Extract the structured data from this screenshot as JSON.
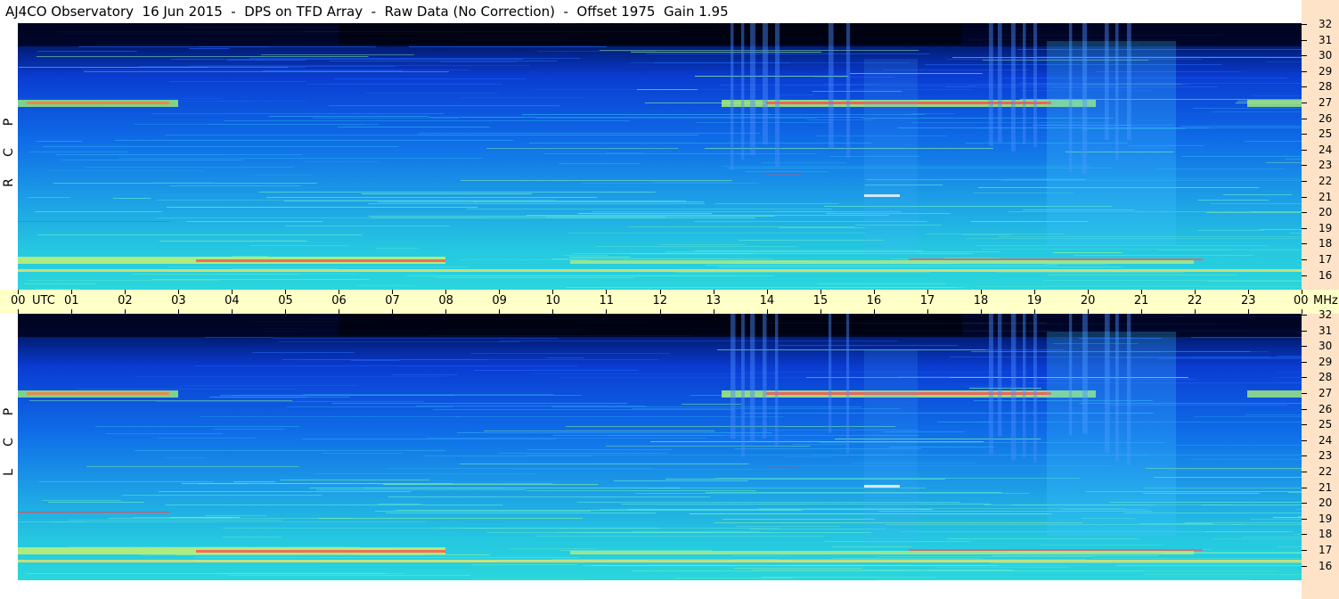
{
  "header": {
    "title": "AJ4CO Observatory  16 Jun 2015  -  DPS on TFD Array  -  Raw Data (No Correction)  -  Offset 1975  Gain 1.95"
  },
  "panels": [
    {
      "id": "rcp",
      "polarization_letters": [
        "R",
        "C",
        "P"
      ]
    },
    {
      "id": "lcp",
      "polarization_letters": [
        "L",
        "C",
        "P"
      ]
    }
  ],
  "frequency_axis": {
    "unit": "MHz",
    "labels": [
      "32",
      "31",
      "30",
      "29",
      "28",
      "27",
      "26",
      "25",
      "24",
      "23",
      "22",
      "21",
      "20",
      "19",
      "18",
      "17",
      "16"
    ]
  },
  "time_axis": {
    "labels": [
      "00",
      "01",
      "02",
      "03",
      "04",
      "05",
      "06",
      "07",
      "08",
      "09",
      "10",
      "11",
      "12",
      "13",
      "14",
      "15",
      "16",
      "17",
      "18",
      "19",
      "20",
      "21",
      "22",
      "23",
      "00"
    ],
    "first_suffix": "UTC",
    "last_suffix": "MHz"
  },
  "colors": {
    "background_deep": "#000a3c",
    "spectrogram_mid": "#0a50e6",
    "spectrogram_high": "#1fc8e6",
    "emission_hot": "#ff4a4a",
    "time_axis_bg": "#ffffc8",
    "freq_axis_bg": "#ffe3c8"
  }
}
